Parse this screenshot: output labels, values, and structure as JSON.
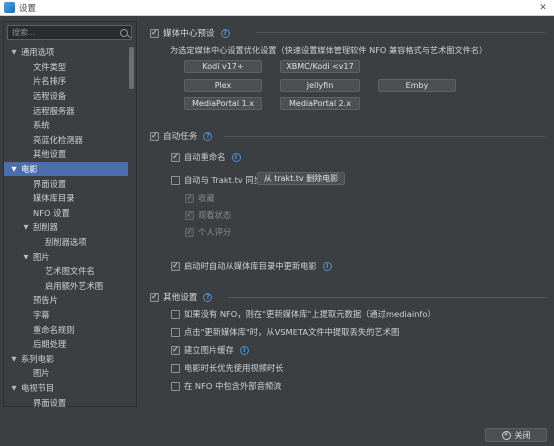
{
  "window": {
    "title": "设置"
  },
  "sidebar": {
    "search_placeholder": "搜索...",
    "items": [
      {
        "label": "通用选项",
        "level": 0,
        "arrow": "▼",
        "selected": false
      },
      {
        "label": "文件类型",
        "level": 1,
        "arrow": "",
        "selected": false
      },
      {
        "label": "片名排序",
        "level": 1,
        "arrow": "",
        "selected": false
      },
      {
        "label": "远程设备",
        "level": 1,
        "arrow": "",
        "selected": false
      },
      {
        "label": "远程服务器",
        "level": 1,
        "arrow": "",
        "selected": false
      },
      {
        "label": "系统",
        "level": 1,
        "arrow": "",
        "selected": false
      },
      {
        "label": "亮蓝化检测器",
        "level": 1,
        "arrow": "",
        "selected": false
      },
      {
        "label": "其他设置",
        "level": 1,
        "arrow": "",
        "selected": false
      },
      {
        "label": "电影",
        "level": 0,
        "arrow": "▼",
        "selected": true
      },
      {
        "label": "界面设置",
        "level": 1,
        "arrow": "",
        "selected": false
      },
      {
        "label": "媒体库目录",
        "level": 1,
        "arrow": "",
        "selected": false
      },
      {
        "label": "NFO 设置",
        "level": 1,
        "arrow": "",
        "selected": false
      },
      {
        "label": "刮削器",
        "level": 1,
        "arrow": "▼",
        "selected": false
      },
      {
        "label": "刮削器选项",
        "level": 2,
        "arrow": "",
        "selected": false
      },
      {
        "label": "图片",
        "level": 1,
        "arrow": "▼",
        "selected": false
      },
      {
        "label": "艺术图文件名",
        "level": 2,
        "arrow": "",
        "selected": false
      },
      {
        "label": "启用额外艺术图",
        "level": 2,
        "arrow": "",
        "selected": false
      },
      {
        "label": "预告片",
        "level": 1,
        "arrow": "",
        "selected": false
      },
      {
        "label": "字幕",
        "level": 1,
        "arrow": "",
        "selected": false
      },
      {
        "label": "重命名规则",
        "level": 1,
        "arrow": "",
        "selected": false
      },
      {
        "label": "后期处理",
        "level": 1,
        "arrow": "",
        "selected": false
      },
      {
        "label": "系列电影",
        "level": 0,
        "arrow": "▼",
        "selected": false
      },
      {
        "label": "图片",
        "level": 1,
        "arrow": "",
        "selected": false
      },
      {
        "label": "电视节目",
        "level": 0,
        "arrow": "▼",
        "selected": false
      },
      {
        "label": "界面设置",
        "level": 1,
        "arrow": "",
        "selected": false
      }
    ]
  },
  "media_center": {
    "title": "媒体中心预设",
    "description": "为选定媒体中心设置优化设置（快速设置媒体管理软件 NFO 兼容格式与艺术图文件名）",
    "buttons": [
      "Kodi v17+",
      "XBMC/Kodi <v17",
      "Plex",
      "Jellyfin",
      "Emby",
      "MediaPortal 1.x",
      "MediaPortal 2.x"
    ]
  },
  "auto_tasks": {
    "title": "自动任务",
    "auto_rename": "自动重命名",
    "trakt_sync": "自动与 Trakt.tv 同步",
    "trakt_delete_button": "从 trakt.tv 删除电影",
    "collection": "收藏",
    "watched": "观看状态",
    "rating": "个人评分",
    "auto_update": "启动时自动从媒体库目录中更新电影"
  },
  "other_settings": {
    "title": "其他设置",
    "opt1": "如果没有 NFO，则在\"更新媒体库\"上提取元数据（通过mediainfo）",
    "opt2": "点击\"更新媒体库\"时，从VSMETA文件中提取丢失的艺术图",
    "opt3": "建立图片缓存",
    "opt4": "电影时长优先使用视频时长",
    "opt5": "在 NFO 中包含外部音频流"
  },
  "footer": {
    "close_label": "关闭"
  },
  "colors": {
    "background": "#3c3f41",
    "selection": "#4b6eaf",
    "accent_blue": "#4a90d9"
  }
}
